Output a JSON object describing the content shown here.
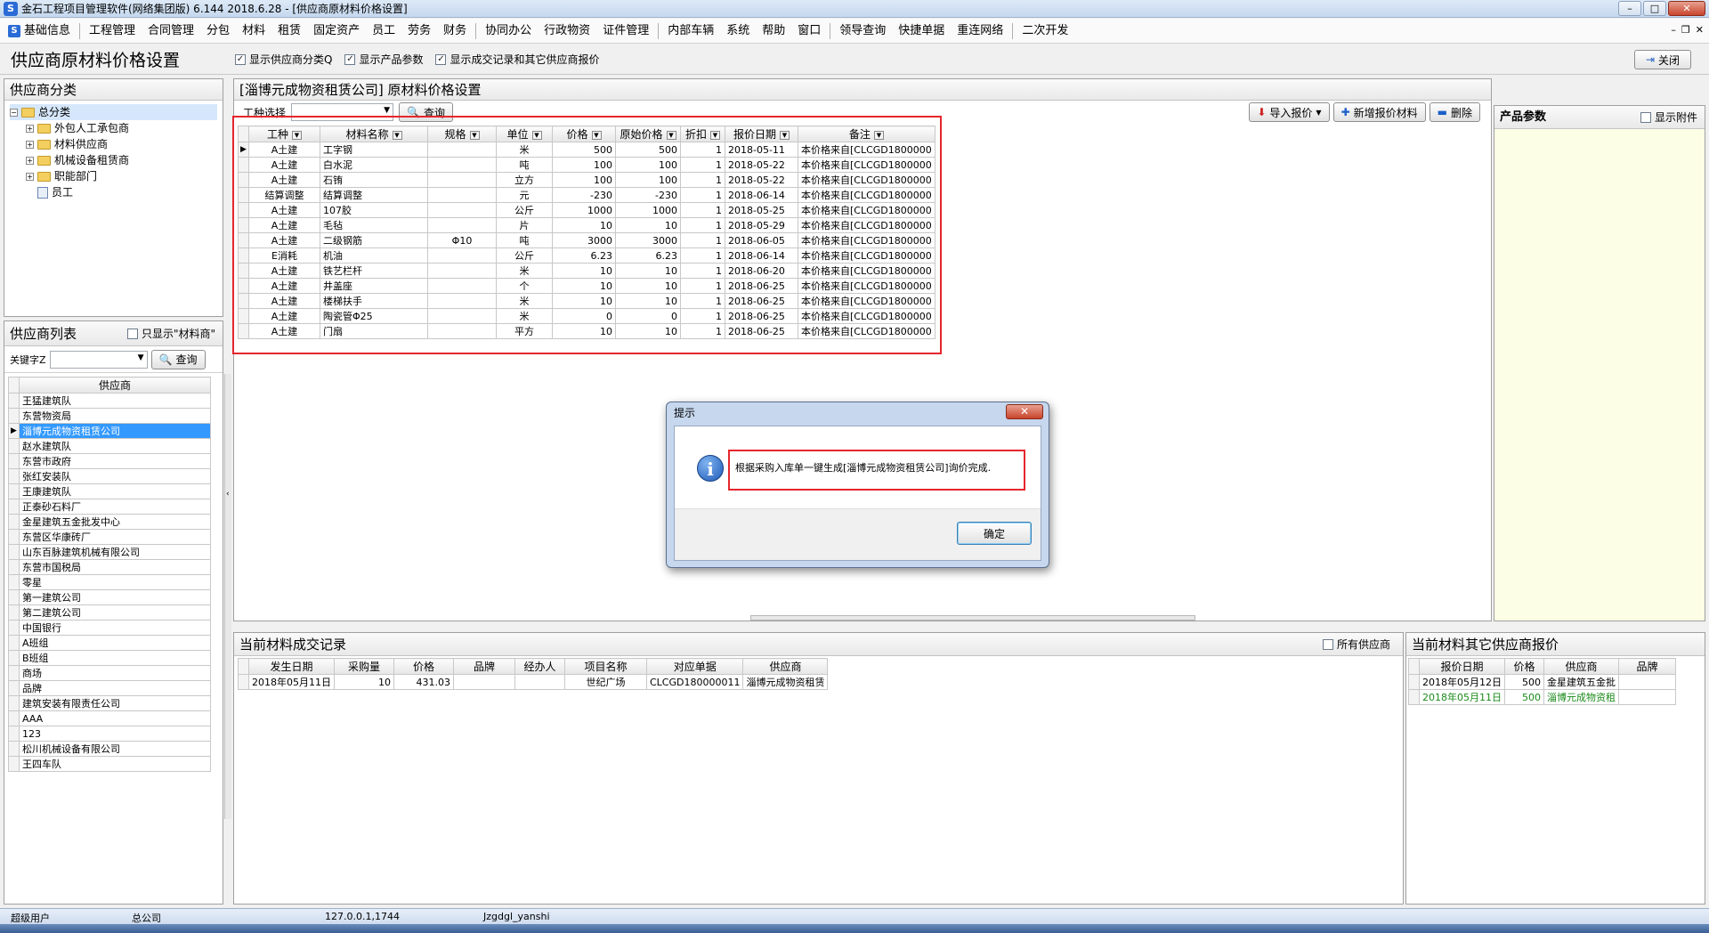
{
  "window": {
    "title": "金石工程项目管理软件(网络集团版) 6.144  2018.6.28 - [供应商原材料价格设置]",
    "app_icon": "S"
  },
  "menu": [
    "基础信息",
    "工程管理",
    "合同管理",
    "分包",
    "材料",
    "租赁",
    "固定资产",
    "员工",
    "劳务",
    "财务",
    "协同办公",
    "行政物资",
    "证件管理",
    "内部车辆",
    "系统",
    "帮助",
    "窗口",
    "领导查询",
    "快捷单据",
    "重连网络",
    "二次开发"
  ],
  "toolbar": {
    "page_title": "供应商原材料价格设置",
    "opt1": "显示供应商分类Q",
    "opt2": "显示产品参数",
    "opt3": "显示成交记录和其它供应商报价",
    "close": "关闭"
  },
  "category_panel": {
    "title": "供应商分类",
    "root": "总分类",
    "children": [
      "外包人工承包商",
      "材料供应商",
      "机械设备租赁商",
      "职能部门"
    ],
    "leaf": "员工"
  },
  "supplier_panel": {
    "title": "供应商列表",
    "only_material": "只显示\"材料商\"",
    "keyword_label": "关键字Z",
    "query": "查询",
    "column": "供应商",
    "rows": [
      "王猛建筑队",
      "东营物资局",
      "淄博元成物资租赁公司",
      "赵水建筑队",
      "东营市政府",
      "张红安装队",
      "王康建筑队",
      "正泰砂石料厂",
      "金星建筑五金批发中心",
      "东营区华康砖厂",
      "山东百脉建筑机械有限公司",
      "东营市国税局",
      "零星",
      "第一建筑公司",
      "第二建筑公司",
      "中国银行",
      "A班组",
      "B班组",
      "商场",
      "品牌",
      "建筑安装有限责任公司",
      "AAA",
      "123",
      "松川机械设备有限公司",
      "王四车队"
    ],
    "selected_index": 2
  },
  "main_panel": {
    "title": "[淄博元成物资租赁公司] 原材料价格设置",
    "work_type_label": "工种选择",
    "query": "查询",
    "import_btn": "导入报价",
    "add_btn": "新增报价材料",
    "delete_btn": "删除",
    "columns": [
      "工种",
      "材料名称",
      "规格",
      "单位",
      "价格",
      "原始价格",
      "折扣",
      "报价日期",
      "备注"
    ],
    "rows": [
      [
        "A土建",
        "工字钢",
        "",
        "米",
        "500",
        "500",
        "1",
        "2018-05-11",
        "本价格来自[CLCGD1800000"
      ],
      [
        "A土建",
        "白水泥",
        "",
        "吨",
        "100",
        "100",
        "1",
        "2018-05-22",
        "本价格来自[CLCGD1800000"
      ],
      [
        "A土建",
        "石铕",
        "",
        "立方",
        "100",
        "100",
        "1",
        "2018-05-22",
        "本价格来自[CLCGD1800000"
      ],
      [
        "结算调整",
        "结算调整",
        "",
        "元",
        "-230",
        "-230",
        "1",
        "2018-06-14",
        "本价格来自[CLCGD1800000"
      ],
      [
        "A土建",
        "107胶",
        "",
        "公斤",
        "1000",
        "1000",
        "1",
        "2018-05-25",
        "本价格来自[CLCGD1800000"
      ],
      [
        "A土建",
        "毛毡",
        "",
        "片",
        "10",
        "10",
        "1",
        "2018-05-29",
        "本价格来自[CLCGD1800000"
      ],
      [
        "A土建",
        "二级钢筋",
        "Φ10",
        "吨",
        "3000",
        "3000",
        "1",
        "2018-06-05",
        "本价格来自[CLCGD1800000"
      ],
      [
        "E消耗",
        "机油",
        "",
        "公斤",
        "6.23",
        "6.23",
        "1",
        "2018-06-14",
        "本价格来自[CLCGD1800000"
      ],
      [
        "A土建",
        "铁艺栏杆",
        "",
        "米",
        "10",
        "10",
        "1",
        "2018-06-20",
        "本价格来自[CLCGD1800000"
      ],
      [
        "A土建",
        "井盖座",
        "",
        "个",
        "10",
        "10",
        "1",
        "2018-06-25",
        "本价格来自[CLCGD1800000"
      ],
      [
        "A土建",
        "楼梯扶手",
        "",
        "米",
        "10",
        "10",
        "1",
        "2018-06-25",
        "本价格来自[CLCGD1800000"
      ],
      [
        "A土建",
        "陶瓷管Φ25",
        "",
        "米",
        "0",
        "0",
        "1",
        "2018-06-25",
        "本价格来自[CLCGD1800000"
      ],
      [
        "A土建",
        "门扇",
        "",
        "平方",
        "10",
        "10",
        "1",
        "2018-06-25",
        "本价格来自[CLCGD1800000"
      ]
    ]
  },
  "params_panel": {
    "title": "产品参数",
    "show_attach": "显示附件"
  },
  "records_panel": {
    "title": "当前材料成交记录",
    "all_suppliers": "所有供应商",
    "columns": [
      "发生日期",
      "采购量",
      "价格",
      "品牌",
      "经办人",
      "项目名称",
      "对应单据",
      "供应商"
    ],
    "rows": [
      [
        "2018年05月11日",
        "10",
        "431.03",
        "",
        "",
        "世纪广场",
        "CLCGD180000011",
        "淄博元成物资租赁"
      ]
    ]
  },
  "other_quotes_panel": {
    "title": "当前材料其它供应商报价",
    "columns": [
      "报价日期",
      "价格",
      "供应商",
      "品牌"
    ],
    "rows": [
      [
        "2018年05月12日",
        "500",
        "金星建筑五金批",
        ""
      ],
      [
        "2018年05月11日",
        "500",
        "淄博元成物资租",
        ""
      ]
    ]
  },
  "dialog": {
    "title": "提示",
    "message": "根据采购入库单一键生成[淄博元成物资租赁公司]询价完成.",
    "ok": "确定"
  },
  "statusbar": {
    "user": "超级用户",
    "company": "总公司",
    "ip": "127.0.0.1,1744",
    "db": "Jzgdgl_yanshi"
  },
  "colors": {
    "highlight": "#e5262c",
    "selection": "#3399ff",
    "params_bg": "#fdfee6"
  }
}
